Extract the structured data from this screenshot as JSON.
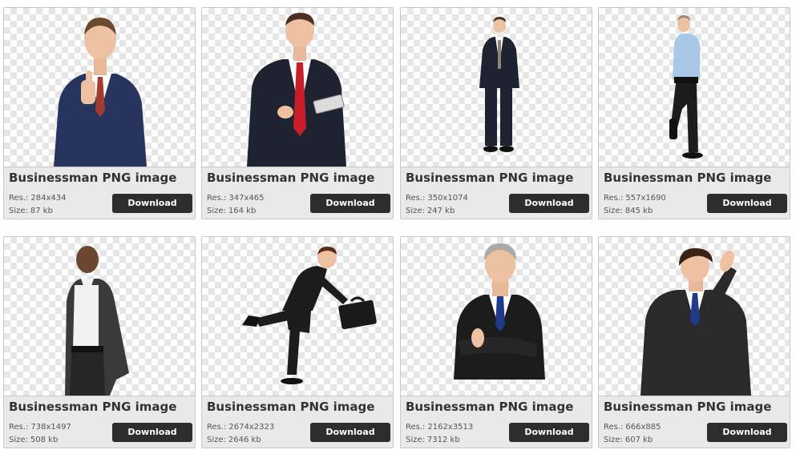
{
  "labels": {
    "res": "Res.:",
    "size": "Size:"
  },
  "cards": [
    {
      "title": "Businessman PNG image",
      "res": "284x434",
      "size": "87 kb",
      "button": "Download",
      "image_icon": "businessman-thumbs-up-icon"
    },
    {
      "title": "Businessman PNG image",
      "res": "347x465",
      "size": "164 kb",
      "button": "Download",
      "image_icon": "businessman-tablet-icon"
    },
    {
      "title": "Businessman PNG image",
      "res": "350x1074",
      "size": "247 kb",
      "button": "Download",
      "image_icon": "businessman-standing-icon"
    },
    {
      "title": "Businessman PNG image",
      "res": "557x1690",
      "size": "845 kb",
      "button": "Download",
      "image_icon": "businessman-leaning-icon"
    },
    {
      "title": "Businessman PNG image",
      "res": "738x1497",
      "size": "508 kb",
      "button": "Download",
      "image_icon": "businessman-casual-icon"
    },
    {
      "title": "Businessman PNG image",
      "res": "2674x2323",
      "size": "2646 kb",
      "button": "Download",
      "image_icon": "businessman-running-icon"
    },
    {
      "title": "Businessman PNG image",
      "res": "2162x3513",
      "size": "7312 kb",
      "button": "Download",
      "image_icon": "businessman-arms-crossed-icon"
    },
    {
      "title": "Businessman PNG image",
      "res": "666x885",
      "size": "607 kb",
      "button": "Download",
      "image_icon": "businessman-facepalm-icon"
    }
  ],
  "colors": {
    "button_bg": "#2d2d2d",
    "card_bg": "#e9e9e9",
    "suit": "#1f2230",
    "navy_suit": "#26345e"
  }
}
